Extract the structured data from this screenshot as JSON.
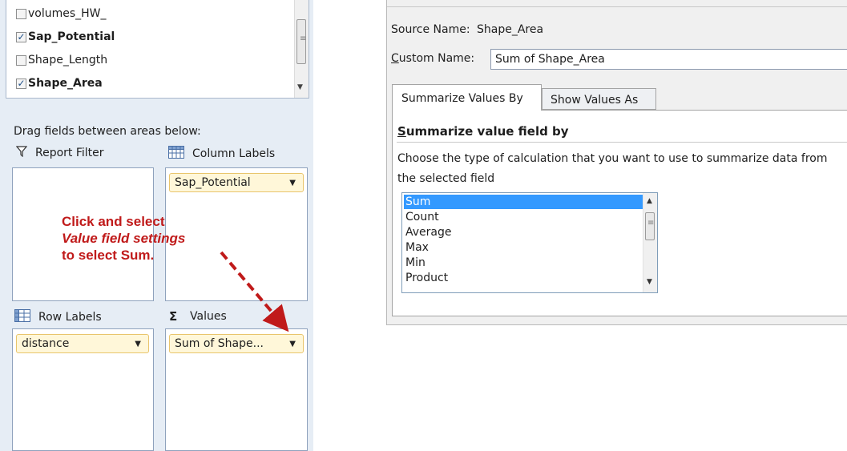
{
  "field_list": {
    "fields": [
      {
        "label": "volumes_HW_",
        "checked": false,
        "bold": false
      },
      {
        "label": "Sap_Potential",
        "checked": true,
        "bold": true
      },
      {
        "label": "Shape_Length",
        "checked": false,
        "bold": false
      },
      {
        "label": "Shape_Area",
        "checked": true,
        "bold": true
      }
    ]
  },
  "areas": {
    "drag_text": "Drag fields between areas below:",
    "report_filter": {
      "label": "Report Filter",
      "icon": "filter-icon"
    },
    "column_labels": {
      "label": "Column Labels",
      "icon": "column-grid-icon",
      "pill": "Sap_Potential"
    },
    "row_labels": {
      "label": "Row Labels",
      "icon": "row-grid-icon",
      "pill": "distance"
    },
    "values": {
      "label": "Values",
      "icon": "sigma-icon",
      "glyph": "Σ",
      "pill": "Sum of Shape..."
    }
  },
  "annotation": {
    "line1": "Click and select",
    "line2": "Value field settings",
    "line3": "to select Sum."
  },
  "dialog": {
    "source_label": "Source Name:",
    "source_value": "Shape_Area",
    "custom_label_first": "C",
    "custom_label_rest": "ustom Name:",
    "custom_value": "Sum of Shape_Area",
    "tab_summarize": "Summarize Values By",
    "tab_showas": "Show Values As",
    "heading_first": "S",
    "heading_rest": "ummarize value field by",
    "description": "Choose the type of calculation that you want to use to summarize data from the selected field",
    "calc_options": [
      "Sum",
      "Count",
      "Average",
      "Max",
      "Min",
      "Product"
    ],
    "selected": "Sum"
  },
  "colors": {
    "annotation": "#c01a1a",
    "selection": "#3399ff",
    "pill_bg": "#fff7d9"
  }
}
